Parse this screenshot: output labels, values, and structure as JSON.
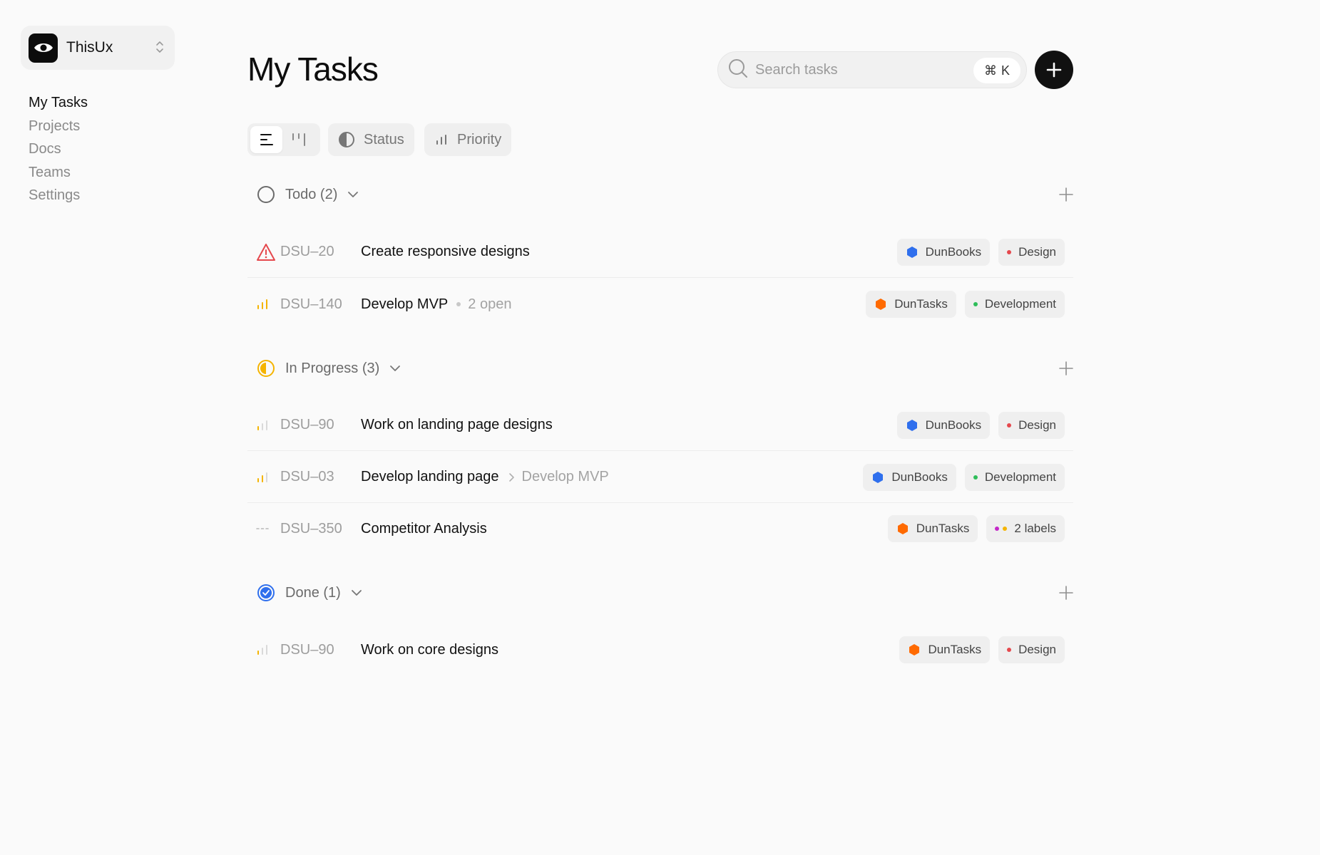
{
  "workspace": {
    "name": "ThisUx"
  },
  "sidebar": {
    "items": [
      {
        "label": "My Tasks"
      },
      {
        "label": "Projects"
      },
      {
        "label": "Docs"
      },
      {
        "label": "Teams"
      },
      {
        "label": "Settings"
      }
    ],
    "active": "My Tasks"
  },
  "header": {
    "title": "My Tasks",
    "search_placeholder": "Search tasks",
    "shortcut_symbol": "⌘",
    "shortcut_key": "K"
  },
  "toolbar": {
    "status_label": "Status",
    "priority_label": "Priority"
  },
  "colors": {
    "blue": "#2f6fed",
    "orange": "#ff6a00",
    "red": "#e5484d",
    "green": "#2ebd59",
    "amber": "#f5b400",
    "purple": "#c428c8"
  },
  "groups": [
    {
      "label": "Todo (2)",
      "status_icon": "todo-circle-icon",
      "tasks": [
        {
          "id": "DSU–20",
          "title": "Create responsive designs",
          "priority": "urgent-icon",
          "tags": [
            {
              "label": "DunBooks",
              "icon": "hex-blue"
            },
            {
              "label": "Design",
              "dot": "red"
            }
          ]
        },
        {
          "id": "DSU–140",
          "title": "Develop MVP",
          "extra": "2 open",
          "priority": "high-priority-icon",
          "tags": [
            {
              "label": "DunTasks",
              "icon": "hex-orange"
            },
            {
              "label": "Development",
              "dot": "green"
            }
          ]
        }
      ]
    },
    {
      "label": "In Progress (3)",
      "status_icon": "in-progress-icon",
      "tasks": [
        {
          "id": "DSU–90",
          "title": "Work on landing page designs",
          "priority": "low-priority-icon",
          "tags": [
            {
              "label": "DunBooks",
              "icon": "hex-blue"
            },
            {
              "label": "Design",
              "dot": "red"
            }
          ]
        },
        {
          "id": "DSU–03",
          "title": "Develop landing page",
          "parent": "Develop MVP",
          "priority": "medium-priority-icon",
          "tags": [
            {
              "label": "DunBooks",
              "icon": "hex-blue"
            },
            {
              "label": "Development",
              "dot": "green"
            }
          ]
        },
        {
          "id": "DSU–350",
          "title": "Competitor Analysis",
          "priority": "no-priority-icon",
          "tags": [
            {
              "label": "DunTasks",
              "icon": "hex-orange"
            },
            {
              "label": "2 labels",
              "dots": [
                "purple",
                "amber"
              ]
            }
          ]
        }
      ]
    },
    {
      "label": "Done (1)",
      "status_icon": "done-check-icon",
      "tasks": [
        {
          "id": "DSU–90",
          "title": "Work on core designs",
          "priority": "low-priority-icon",
          "tags": [
            {
              "label": "DunTasks",
              "icon": "hex-orange"
            },
            {
              "label": "Design",
              "dot": "red"
            }
          ]
        }
      ]
    }
  ]
}
